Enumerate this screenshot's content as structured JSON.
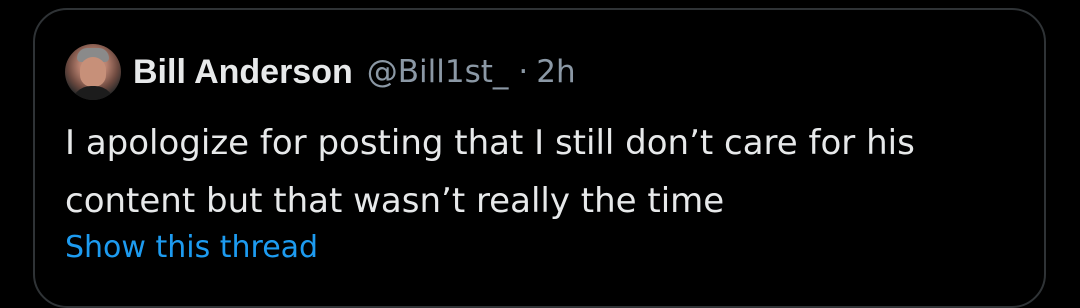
{
  "quoted_post": {
    "author": {
      "name": "Bill Anderson",
      "handle": "@Bill1st_",
      "avatar_icon": "user-avatar"
    },
    "separator": "·",
    "time": "2h",
    "text": "I apologize for posting that I still don’t care for his content but that wasn’t really the time",
    "show_thread_label": "Show this thread",
    "colors": {
      "background": "#000000",
      "border": "#2f3336",
      "primary_text": "#e7e9ea",
      "secondary_text": "#8b98a5",
      "link": "#1d9bf0"
    }
  }
}
